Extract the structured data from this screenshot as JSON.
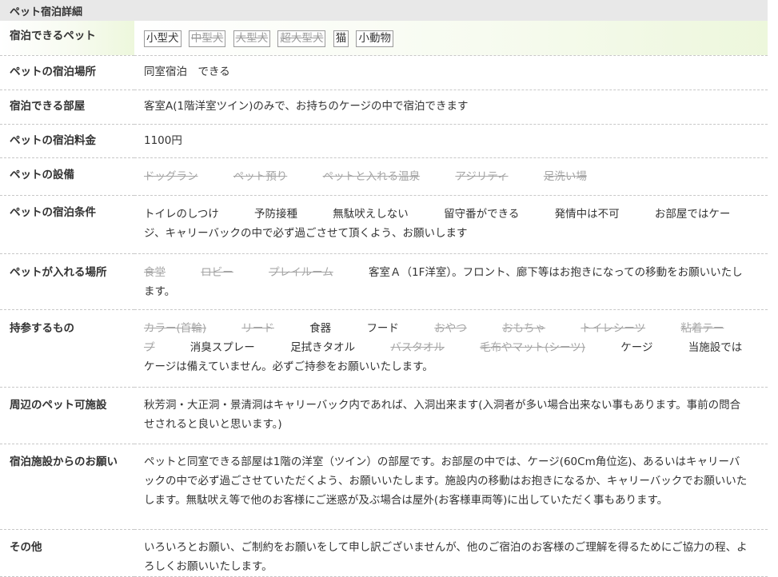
{
  "header": {
    "title": "ペット宿泊詳細"
  },
  "rows": {
    "pets": {
      "label": "宿泊できるペット",
      "tags": [
        {
          "text": "小型犬",
          "ok": true
        },
        {
          "text": "中型犬",
          "ok": false
        },
        {
          "text": "大型犬",
          "ok": false
        },
        {
          "text": "超大型犬",
          "ok": false
        },
        {
          "text": "猫",
          "ok": true
        },
        {
          "text": "小動物",
          "ok": true
        }
      ]
    },
    "place": {
      "label": "ペットの宿泊場所",
      "value": "同室宿泊　できる"
    },
    "room": {
      "label": "宿泊できる部屋",
      "value": "客室A(1階洋室ツイン)のみで、お持ちのケージの中で宿泊できます"
    },
    "fee": {
      "label": "ペットの宿泊料金",
      "value": "1100円"
    },
    "facilities": {
      "label": "ペットの設備",
      "items": [
        {
          "text": "ドッグラン",
          "ok": false
        },
        {
          "text": "ペット預り",
          "ok": false
        },
        {
          "text": "ペットと入れる温泉",
          "ok": false
        },
        {
          "text": "アジリティ",
          "ok": false
        },
        {
          "text": "足洗い場",
          "ok": false
        }
      ]
    },
    "conditions": {
      "label": "ペットの宿泊条件",
      "items": [
        {
          "text": "トイレのしつけ",
          "ok": true
        },
        {
          "text": "予防接種",
          "ok": true
        },
        {
          "text": "無駄吠えしない",
          "ok": true
        },
        {
          "text": "留守番ができる",
          "ok": true
        },
        {
          "text": "発情中は不可",
          "ok": true
        }
      ],
      "note": "お部屋ではケージ、キャリーバックの中で必ず過ごさせて頂くよう、お願いします"
    },
    "areas": {
      "label": "ペットが入れる場所",
      "items": [
        {
          "text": "食堂",
          "ok": false
        },
        {
          "text": "ロビー",
          "ok": false
        },
        {
          "text": "プレイルーム",
          "ok": false
        },
        {
          "text": "客室Ａ（1F洋室）",
          "ok": true
        }
      ],
      "note": "。フロント、廊下等はお抱きになっての移動をお願いいたします。"
    },
    "bring": {
      "label": "持参するもの",
      "items": [
        {
          "text": "カラー(首輪)",
          "ok": false
        },
        {
          "text": "リード",
          "ok": false
        },
        {
          "text": "食器",
          "ok": true
        },
        {
          "text": "フード",
          "ok": true
        },
        {
          "text": "おやつ",
          "ok": false
        },
        {
          "text": "おもちゃ",
          "ok": false
        },
        {
          "text": "トイレシーツ",
          "ok": false
        },
        {
          "text": "粘着テープ",
          "ok": false
        },
        {
          "text": "消臭スプレー",
          "ok": true
        },
        {
          "text": "足拭きタオル",
          "ok": true
        },
        {
          "text": "バスタオル",
          "ok": false
        },
        {
          "text": "毛布やマット(シーツ)",
          "ok": false
        },
        {
          "text": "ケージ",
          "ok": true
        }
      ],
      "note": "当施設ではケージは備えていません。必ずご持参をお願いいたします。"
    },
    "nearby": {
      "label": "周辺のペット可施設",
      "value": "秋芳洞・大正洞・景清洞はキャリーバック内であれば、入洞出来ます(入洞者が多い場合出来ない事もあります。事前の問合せされると良いと思います。)"
    },
    "request": {
      "label": "宿泊施設からのお願い",
      "value": "ペットと同室できる部屋は1階の洋室（ツイン）の部屋です。お部屋の中では、ケージ(60Cm角位迄)、あるいはキャリーバックの中で必ず過ごさせていただくよう、お願いいたします。施設内の移動はお抱きになるか、キャリーバックでお願いいたします。無駄吠え等で他のお客様にご迷惑が及ぶ場合は屋外(お客様車両等)に出していただく事もあります。"
    },
    "other": {
      "label": "その他",
      "value": "いろいろとお願い、ご制約をお願いをして申し訳ございませんが、他のご宿泊のお客様のご理解を得るためにご協力の程、よろしくお願いいたします。"
    }
  }
}
